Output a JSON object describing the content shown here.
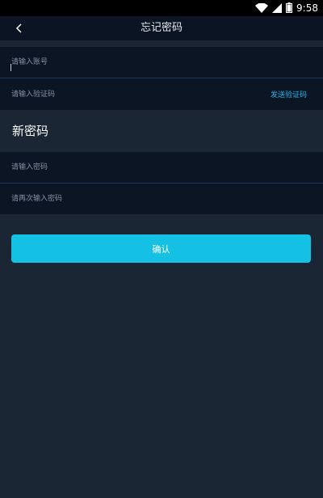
{
  "status_bar": {
    "time": "9:58",
    "icons": [
      "wifi-icon",
      "cell-signal-icon",
      "battery-icon"
    ]
  },
  "header": {
    "title": "忘记密码",
    "back_icon": "chevron-left-icon"
  },
  "form": {
    "account_placeholder": "请输入账号",
    "code_placeholder": "请输入验证码",
    "send_code_label": "发送验证码",
    "new_password_heading": "新密码",
    "password_placeholder": "请输入密码",
    "password_again_placeholder": "请再次输入密码",
    "confirm_label": "确认"
  },
  "colors": {
    "background": "#1b2634",
    "field_background": "#0b1524",
    "accent": "#14c1e4",
    "link": "#27b5e8"
  }
}
